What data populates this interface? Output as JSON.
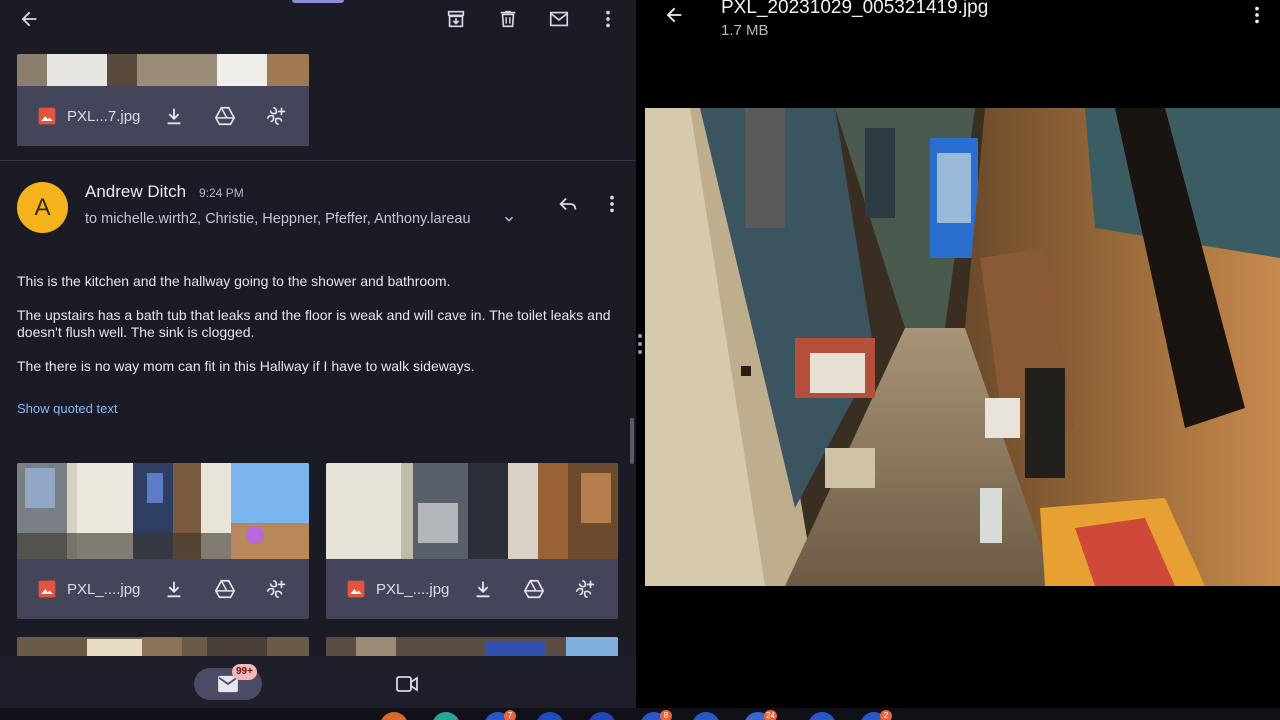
{
  "gmail": {
    "top_attachment": {
      "filename": "PXL...7.jpg"
    },
    "message": {
      "avatar_letter": "A",
      "sender": "Andrew Ditch",
      "time": "9:24 PM",
      "recipients": "to michelle.wirth2, Christie, Heppner, Pfeffer, Anthony.lareau",
      "paragraphs": [
        "This is the kitchen and the hallway going to the shower and bathroom.",
        "The upstairs has a bath tub that leaks and the floor is weak and will cave in. The toilet leaks and doesn't flush well. The sink is clogged.",
        "The there is no way mom can fit in this Hallway if I have to walk sideways."
      ],
      "show_quoted": "Show quoted text"
    },
    "attachments": [
      {
        "filename": "PXL_....jpg"
      },
      {
        "filename": "PXL_....jpg"
      }
    ],
    "bottom_nav": {
      "mail_badge": "99+"
    }
  },
  "viewer": {
    "title": "PXL_20231029_005321419.jpg",
    "size": "1.7 MB"
  },
  "taskbar": {
    "badges": [
      "7",
      "8",
      "24",
      "2"
    ]
  },
  "icons": {
    "back": "arrow-left-icon",
    "archive": "archive-icon",
    "delete": "trash-icon",
    "mark_unread": "mail-icon",
    "more": "more-vert-icon",
    "reply": "reply-icon",
    "download": "download-icon",
    "drive": "drive-icon",
    "add_to_photos": "add-to-photos-icon",
    "video": "video-icon"
  },
  "colors": {
    "pane_bg": "#1b1b26",
    "card_bg": "#44445a",
    "avatar": "#f6b31c",
    "link": "#8ab4f8",
    "badge": "#f2b8b5"
  }
}
